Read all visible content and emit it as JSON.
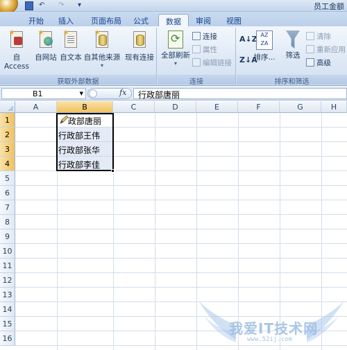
{
  "window": {
    "title": "员工金额"
  },
  "quick_access": {
    "undo_glyph": "↶",
    "redo_glyph": "↷",
    "more_glyph": "▾"
  },
  "tabs": [
    {
      "label": "开始",
      "active": false
    },
    {
      "label": "插入",
      "active": false
    },
    {
      "label": "页面布局",
      "active": false
    },
    {
      "label": "公式",
      "active": false
    },
    {
      "label": "数据",
      "active": true
    },
    {
      "label": "审阅",
      "active": false
    },
    {
      "label": "视图",
      "active": false
    }
  ],
  "ribbon": {
    "get_external": {
      "label": "获取外部数据",
      "buttons": [
        {
          "label": "自 Access",
          "icon": "access-icon"
        },
        {
          "label": "自网站",
          "icon": "web-icon"
        },
        {
          "label": "自文本",
          "icon": "text-icon"
        },
        {
          "label": "自其他来源",
          "icon": "other-sources-icon"
        },
        {
          "label": "现有连接",
          "icon": "existing-connections-icon"
        }
      ]
    },
    "connections": {
      "label": "连接",
      "refresh_all": "全部刷新",
      "items": [
        {
          "label": "连接",
          "enabled": true
        },
        {
          "label": "属性",
          "enabled": false
        },
        {
          "label": "编辑链接",
          "enabled": false
        }
      ]
    },
    "sort_filter": {
      "label": "排序和筛选",
      "sort_label": "排序...",
      "filter_label": "筛选",
      "items": [
        {
          "label": "清除",
          "enabled": false
        },
        {
          "label": "重新应用",
          "enabled": false
        },
        {
          "label": "高级",
          "enabled": true
        }
      ]
    }
  },
  "formula_bar": {
    "name_box": "B1",
    "fx": "fx",
    "value": "行政部唐丽"
  },
  "grid": {
    "columns": [
      "A",
      "B",
      "C",
      "D",
      "E",
      "F",
      "G",
      "H"
    ],
    "selected_column": "B",
    "rows": [
      "1",
      "2",
      "3",
      "4",
      "5",
      "6",
      "7",
      "8",
      "9",
      "10",
      "11",
      "12",
      "13",
      "14",
      "15",
      "16"
    ],
    "cells_b": [
      "政部唐丽",
      "行政部王伟",
      "行政部张华",
      "行政部李佳"
    ]
  },
  "watermark": {
    "text": "我爱IT技术网",
    "url": "www.52ij.com"
  },
  "colors": {
    "ribbon_tab_active": "#f3f7fc",
    "selection_header": "#f1c15f",
    "grid_line": "#d4dde9"
  }
}
